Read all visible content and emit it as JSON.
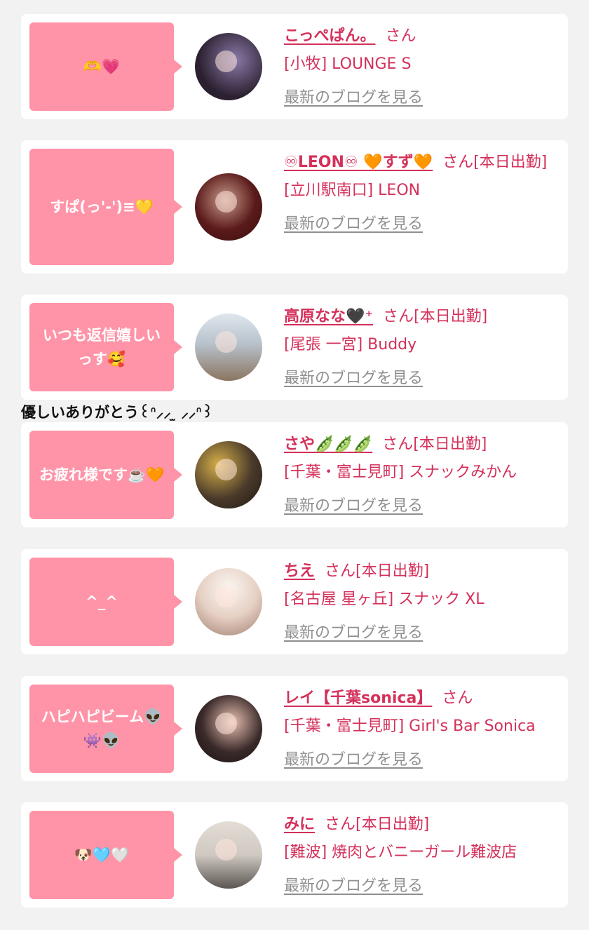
{
  "entries": [
    {
      "message": "🫶💗",
      "name": "こっぺぱん。",
      "san": "さん",
      "shop": "[小牧] LOUNGE S",
      "blog_link": "最新のブログを見る",
      "avatar_color": "#2b2030"
    },
    {
      "message": "すぱ(っ'-')≡💛",
      "name": "♾LEON♾ 🧡すず🧡",
      "san": "さん[本日出勤]",
      "shop": "[立川駅南口] LEON",
      "blog_link": "最新のブログを見る",
      "avatar_color": "#5a1a1a"
    },
    {
      "message": "いつも返信嬉しいっす🥰",
      "name": "高原なな🖤⁺",
      "san": "さん[本日出勤]",
      "shop": "[尾張 一宮] Buddy",
      "blog_link": "最新のブログを見る",
      "avatar_color": "#b8c2cc"
    },
    {
      "message": "お疲れ様です☕️🧡",
      "name": "さや🫛🫛🫛",
      "san": "さん[本日出勤]",
      "shop": "[千葉・富士見町] スナックみかん",
      "blog_link": "最新のブログを見る",
      "avatar_color": "#4a3a2a"
    },
    {
      "message": "^_^",
      "name": "ちえ",
      "san": "さん[本日出勤]",
      "shop": "[名古屋 星ヶ丘] スナック XL",
      "blog_link": "最新のブログを見る",
      "avatar_color": "#e6d0c4"
    },
    {
      "message": "ハピハピビーム👽👾👽",
      "name": "レイ【千葉sonica】",
      "san": "さん",
      "shop": "[千葉・富士見町] Girl's Bar Sonica",
      "blog_link": "最新のブログを見る",
      "avatar_color": "#3a2a2a"
    },
    {
      "message": "🐶🩵🤍",
      "name": "みに",
      "san": "さん[本日出勤]",
      "shop": "[難波] 焼肉とバニーガール難波店",
      "blog_link": "最新のブログを見る",
      "avatar_color": "#cfc9c2"
    }
  ],
  "overflow_text": "優しいありがとう꒰ᐢ⸝⸝ ̫ ⸝⸝ᐢ꒱"
}
